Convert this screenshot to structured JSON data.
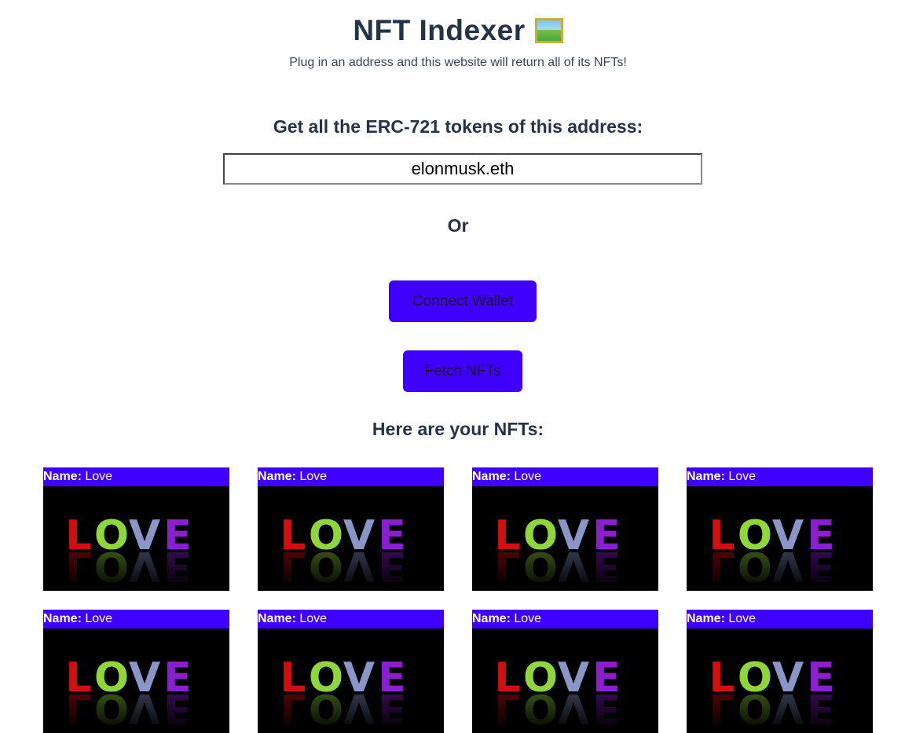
{
  "header": {
    "title": "NFT Indexer",
    "title_icon": "framed-picture-icon",
    "subtitle": "Plug in an address and this website will return all of its NFTs!"
  },
  "form": {
    "heading": "Get all the ERC-721 tokens of this address:",
    "address_value": "elonmusk.eth",
    "or_label": "Or",
    "connect_label": "Connect Wallet",
    "fetch_label": "Fetch NFTs"
  },
  "results": {
    "heading": "Here are your NFTs:",
    "name_label": "Name:",
    "cards": [
      {
        "name": "Love",
        "image_text": "LOVE"
      },
      {
        "name": "Love",
        "image_text": "LOVE"
      },
      {
        "name": "Love",
        "image_text": "LOVE"
      },
      {
        "name": "Love",
        "image_text": "LOVE"
      },
      {
        "name": "Love",
        "image_text": "LOVE"
      },
      {
        "name": "Love",
        "image_text": "LOVE"
      },
      {
        "name": "Love",
        "image_text": "LOVE"
      },
      {
        "name": "Love",
        "image_text": "LOVE"
      }
    ]
  },
  "colors": {
    "accent": "#4000ff",
    "heading": "#243448",
    "card_bg": "#000000",
    "letter_colors": [
      "#d01010",
      "#8fd63a",
      "#8a96c8",
      "#8a1fd0"
    ]
  }
}
